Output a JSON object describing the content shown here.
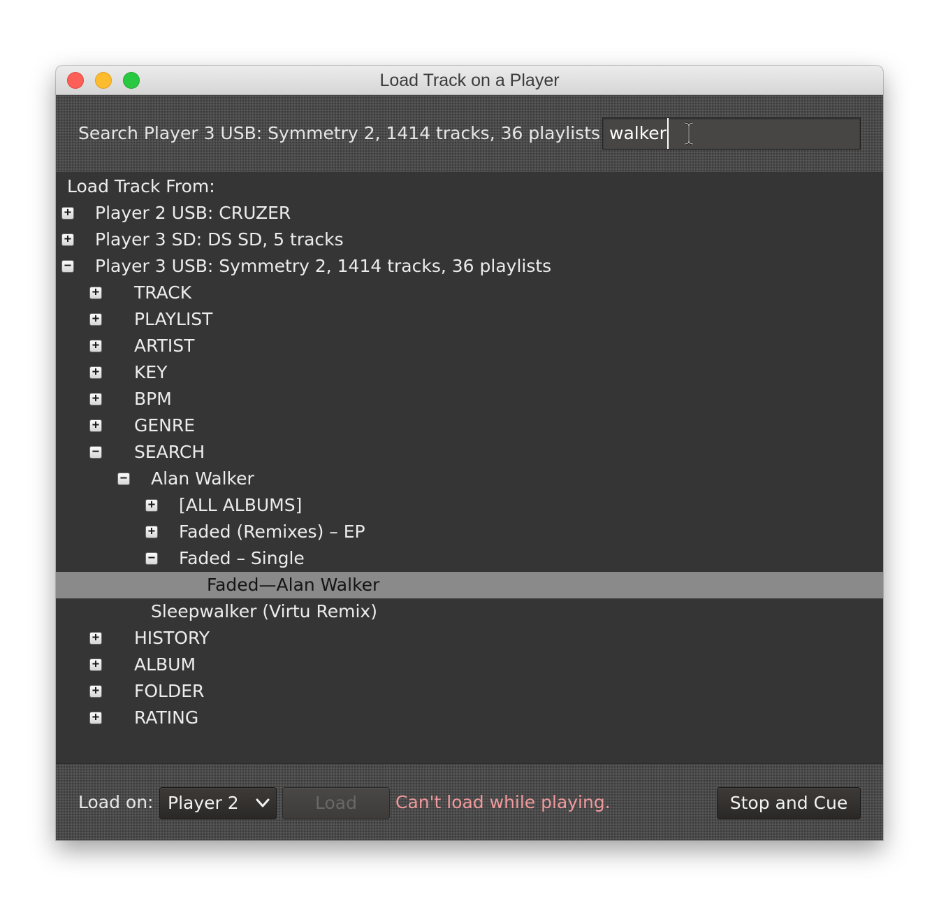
{
  "window": {
    "title": "Load Track on a Player"
  },
  "search": {
    "label": "Search Player 3 USB: Symmetry 2, 1414 tracks, 36 playlists:",
    "value": "walker"
  },
  "tree": {
    "root_label": "Load Track From:",
    "nodes": [
      {
        "label": "Player 2 USB: CRUZER",
        "level": 0,
        "toggle": "+",
        "expanded": false
      },
      {
        "label": "Player 3 SD: DS SD, 5 tracks",
        "level": 0,
        "toggle": "+",
        "expanded": false
      },
      {
        "label": "Player 3 USB: Symmetry 2, 1414 tracks, 36 playlists",
        "level": 0,
        "toggle": "−",
        "expanded": true
      },
      {
        "label": "TRACK",
        "level": 1,
        "toggle": "+",
        "expanded": false
      },
      {
        "label": "PLAYLIST",
        "level": 1,
        "toggle": "+",
        "expanded": false
      },
      {
        "label": "ARTIST",
        "level": 1,
        "toggle": "+",
        "expanded": false
      },
      {
        "label": "KEY",
        "level": 1,
        "toggle": "+",
        "expanded": false
      },
      {
        "label": "BPM",
        "level": 1,
        "toggle": "+",
        "expanded": false
      },
      {
        "label": "GENRE",
        "level": 1,
        "toggle": "+",
        "expanded": false
      },
      {
        "label": "SEARCH",
        "level": 1,
        "toggle": "−",
        "expanded": true
      },
      {
        "label": "Alan Walker",
        "level": 2,
        "toggle": "−",
        "expanded": true
      },
      {
        "label": "[ALL ALBUMS]",
        "level": 3,
        "toggle": "+",
        "expanded": false
      },
      {
        "label": "Faded (Remixes) – EP",
        "level": 3,
        "toggle": "+",
        "expanded": false
      },
      {
        "label": "Faded – Single",
        "level": 3,
        "toggle": "−",
        "expanded": true
      },
      {
        "label": "Faded—Alan Walker",
        "level": 4,
        "toggle": "",
        "selected": true
      },
      {
        "label": "Sleepwalker (Virtu Remix)",
        "level": 2,
        "toggle": ""
      },
      {
        "label": "HISTORY",
        "level": 1,
        "toggle": "+",
        "expanded": false
      },
      {
        "label": "ALBUM",
        "level": 1,
        "toggle": "+",
        "expanded": false
      },
      {
        "label": "FOLDER",
        "level": 1,
        "toggle": "+",
        "expanded": false
      },
      {
        "label": "RATING",
        "level": 1,
        "toggle": "+",
        "expanded": false
      }
    ]
  },
  "footer": {
    "load_on_label": "Load on:",
    "player_select": {
      "value": "Player 2",
      "icon": "chevron-down-icon"
    },
    "load_button": {
      "label": "Load",
      "enabled": false
    },
    "status_message": "Can't load while playing.",
    "stop_cue_button": "Stop and Cue"
  },
  "colors": {
    "status_error": "#f09a9d",
    "selection": "#8a8a8a",
    "tree_background": "#353535"
  }
}
